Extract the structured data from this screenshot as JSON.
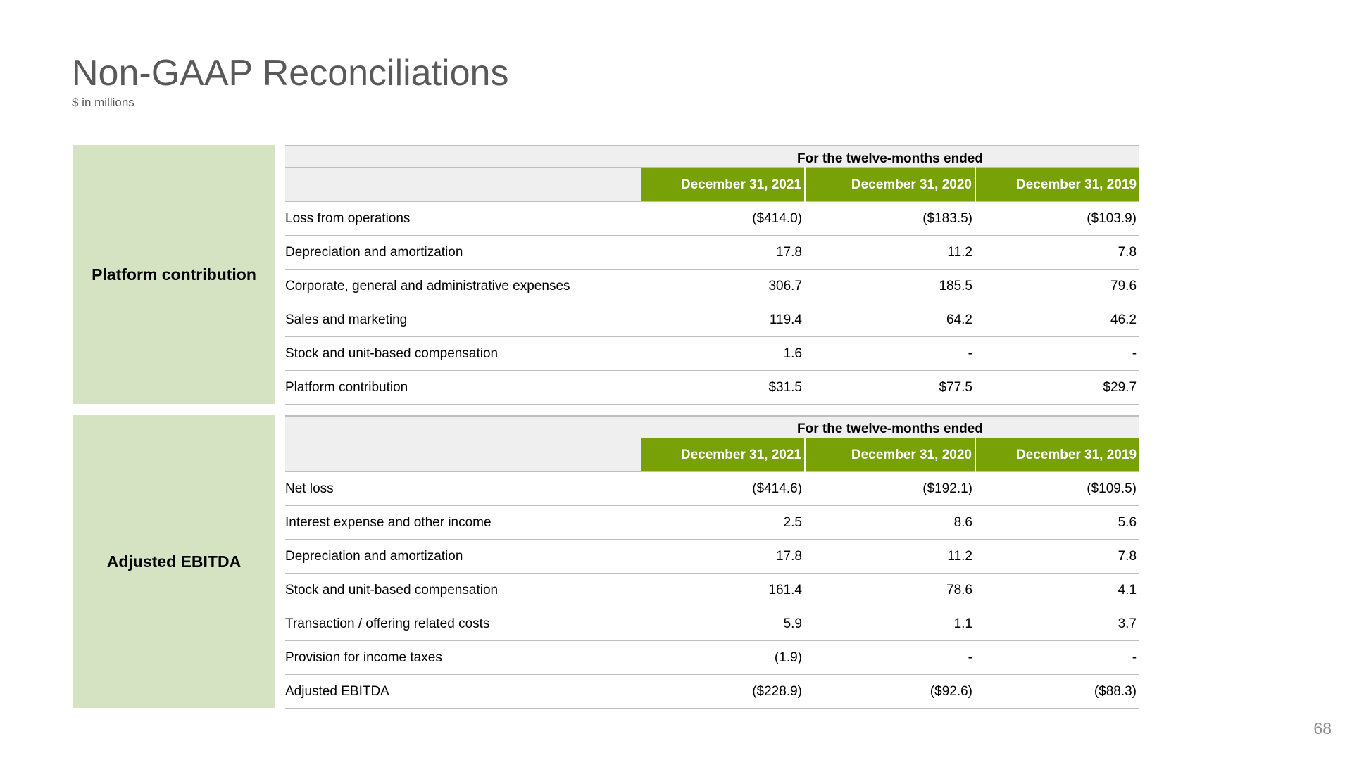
{
  "page": {
    "title": "Non-GAAP Reconciliations",
    "subtitle": "$ in millions",
    "page_number": "68"
  },
  "colors": {
    "header_green": "#77a106",
    "side_panel_green": "#d6e3c3",
    "header_gray": "#efefef",
    "title_gray": "#595959"
  },
  "tables": [
    {
      "side_label": "Platform contribution",
      "period_caption": "For the twelve-months ended",
      "columns": [
        "December 31, 2021",
        "December 31, 2020",
        "December 31, 2019"
      ],
      "rows": [
        {
          "label": "Loss from operations",
          "values": [
            "($414.0)",
            "($183.5)",
            "($103.9)"
          ]
        },
        {
          "label": "Depreciation and amortization",
          "values": [
            "17.8",
            "11.2",
            "7.8"
          ]
        },
        {
          "label": "Corporate, general and administrative expenses",
          "values": [
            "306.7",
            "185.5",
            "79.6"
          ]
        },
        {
          "label": "Sales and marketing",
          "values": [
            "119.4",
            "64.2",
            "46.2"
          ]
        },
        {
          "label": "Stock and unit-based compensation",
          "values": [
            "1.6",
            "-",
            "-"
          ]
        },
        {
          "label": "Platform contribution",
          "values": [
            "$31.5",
            "$77.5",
            "$29.7"
          ]
        }
      ]
    },
    {
      "side_label": "Adjusted EBITDA",
      "period_caption": "For the twelve-months ended",
      "columns": [
        "December 31, 2021",
        "December 31, 2020",
        "December 31, 2019"
      ],
      "rows": [
        {
          "label": "Net loss",
          "values": [
            "($414.6)",
            "($192.1)",
            "($109.5)"
          ]
        },
        {
          "label": "Interest expense and other income",
          "values": [
            "2.5",
            "8.6",
            "5.6"
          ]
        },
        {
          "label": "Depreciation and amortization",
          "values": [
            "17.8",
            "11.2",
            "7.8"
          ]
        },
        {
          "label": "Stock and unit-based compensation",
          "values": [
            "161.4",
            "78.6",
            "4.1"
          ]
        },
        {
          "label": "Transaction / offering related costs",
          "values": [
            "5.9",
            "1.1",
            "3.7"
          ]
        },
        {
          "label": "Provision for income taxes",
          "values": [
            "(1.9)",
            "-",
            "-"
          ]
        },
        {
          "label": "Adjusted EBITDA",
          "values": [
            "($228.9)",
            "($92.6)",
            "($88.3)"
          ]
        }
      ]
    }
  ]
}
